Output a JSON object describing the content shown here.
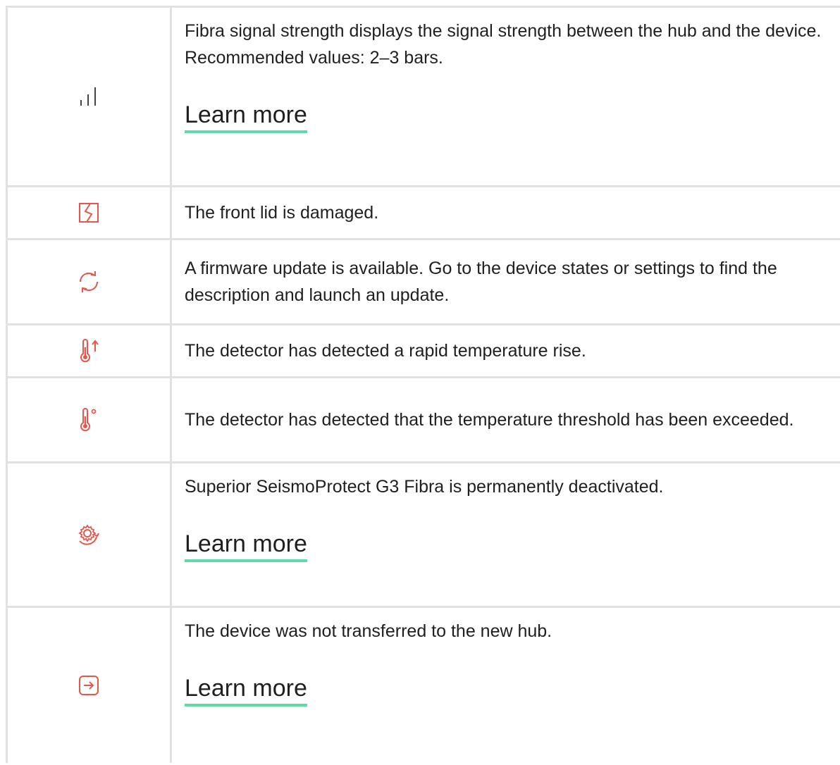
{
  "rows": [
    {
      "icon": "signal-bars-icon",
      "text": "Fibra signal strength displays the signal strength between the hub and the device. Recommended values: 2–3 bars.",
      "link": "Learn more"
    },
    {
      "icon": "damaged-lid-icon",
      "text": "The front lid is damaged."
    },
    {
      "icon": "firmware-update-icon",
      "text": "A firmware update is available. Go to the device states or settings to find the description and launch an update."
    },
    {
      "icon": "temperature-rise-icon",
      "text": "The detector has detected a rapid temperature rise."
    },
    {
      "icon": "temperature-threshold-icon",
      "text": "The detector has detected that the temperature threshold has been exceeded."
    },
    {
      "icon": "deactivated-gear-icon",
      "text": "Superior SeismoProtect G3 Fibra is permanently deactivated.",
      "link": "Learn more"
    },
    {
      "icon": "transfer-icon",
      "text": "The device was not transferred to the new hub.",
      "link": "Learn more"
    }
  ],
  "colors": {
    "icon_red": "#e5574c",
    "icon_gray": "#444444",
    "link_underline": "#5fdca6",
    "border": "#e1e1e1"
  }
}
